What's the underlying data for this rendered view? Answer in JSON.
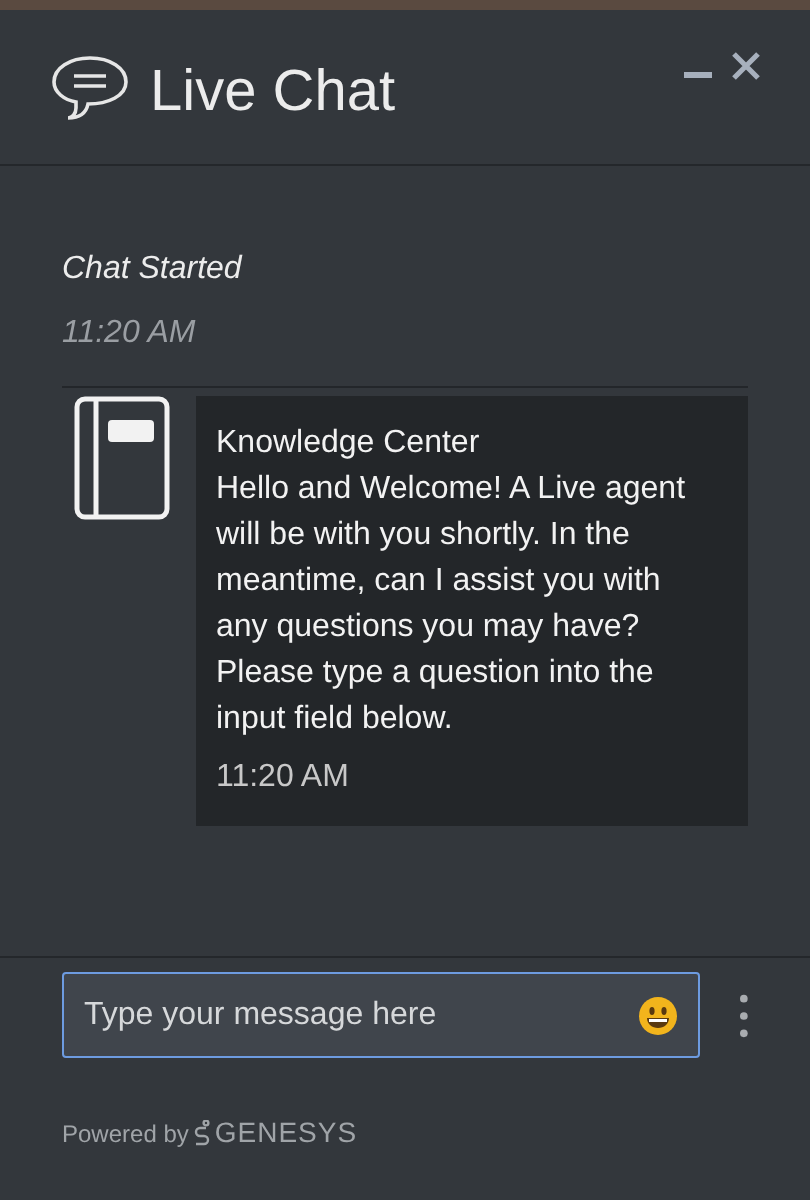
{
  "header": {
    "title": "Live Chat"
  },
  "chat_started": {
    "label": "Chat Started",
    "time": "11:20 AM"
  },
  "messages": [
    {
      "sender": "Knowledge Center",
      "text": "Hello and Welcome! A Live agent will be with you shortly. In the meantime, can I assist you with any questions you may have? Please type a question into the input field below.",
      "time": "11:20 AM"
    }
  ],
  "composer": {
    "placeholder": "Type your message here"
  },
  "footer": {
    "powered_by": "Powered by",
    "brand": "GENESYS"
  }
}
